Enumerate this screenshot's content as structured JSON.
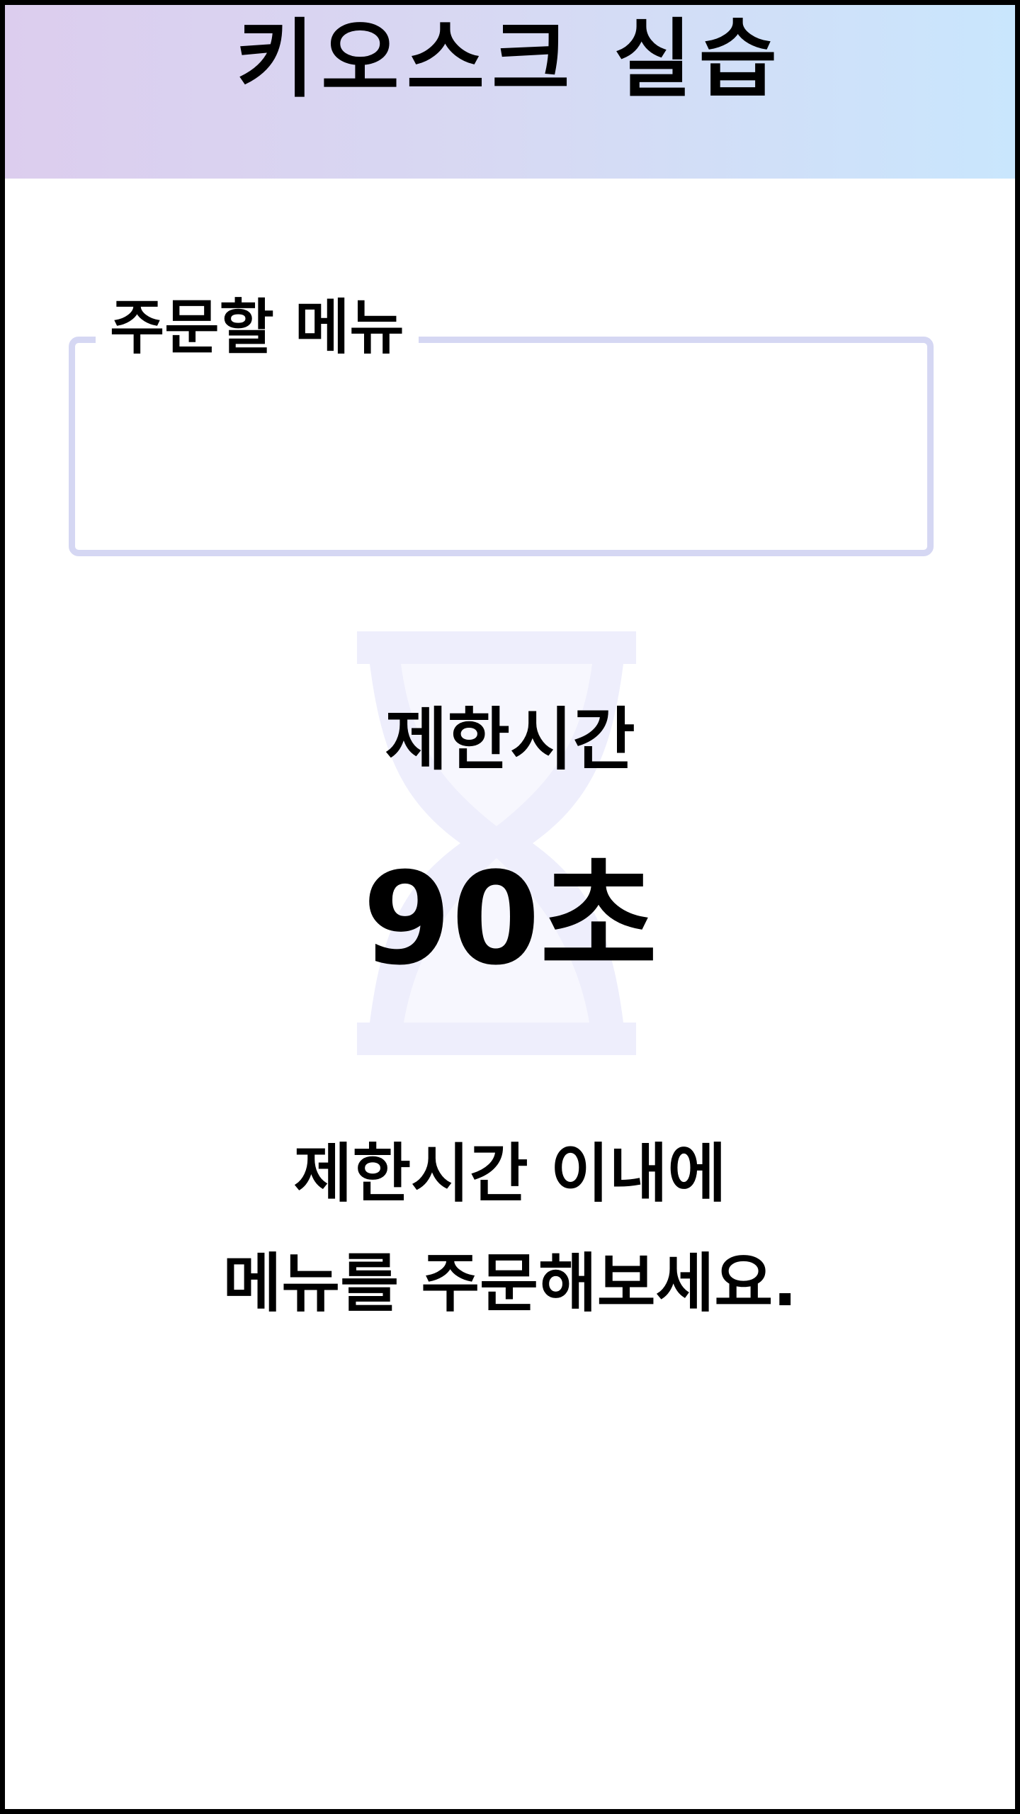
{
  "header": {
    "title": "키오스크 실습"
  },
  "order_panel": {
    "label": "주문할 메뉴"
  },
  "timer": {
    "label": "제한시간",
    "value": "90초",
    "icon": "hourglass-icon"
  },
  "instruction": {
    "line1": "제한시간 이내에",
    "line2": "메뉴를 주문해보세요."
  },
  "colors": {
    "header_gradient_start": "#dccdee",
    "header_gradient_end": "#c9e6fd",
    "panel_border": "#d5d7f3",
    "hourglass": "#eeeefc",
    "frame_border": "#000000"
  }
}
